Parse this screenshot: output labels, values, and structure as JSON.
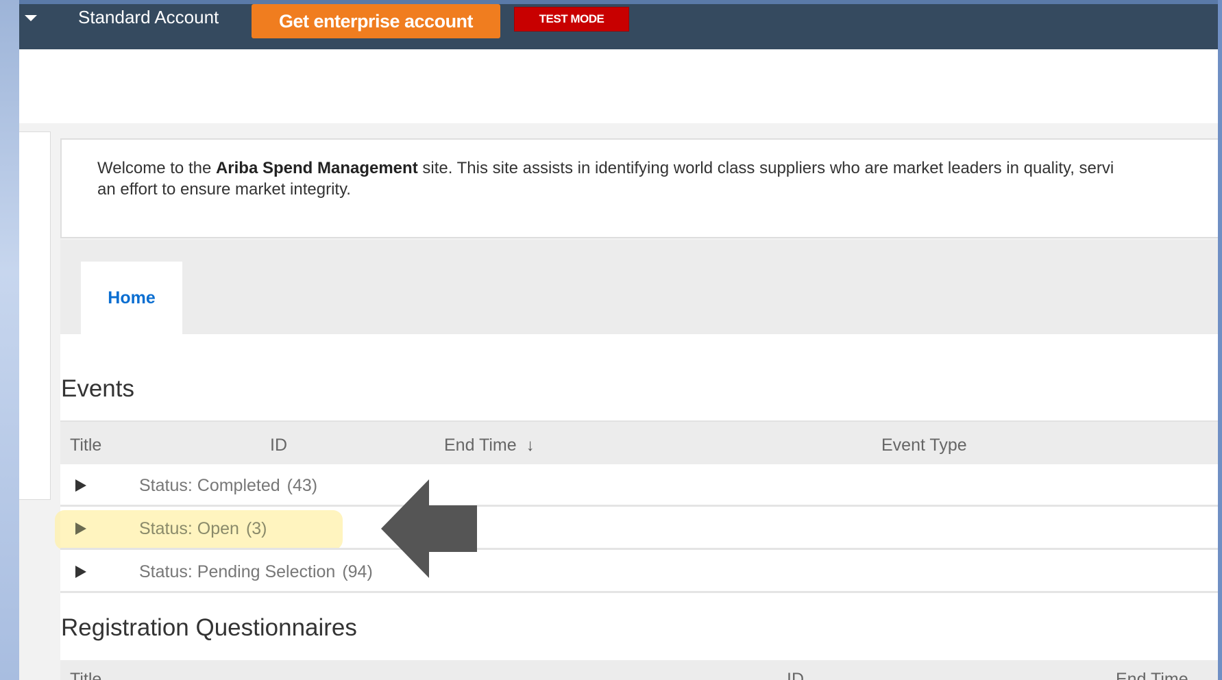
{
  "topbar": {
    "account_name": "Standard Account",
    "enterprise_button": "Get enterprise account",
    "test_mode_badge": "TEST MODE",
    "colors": {
      "bar": "#354a5f",
      "enterprise": "#f07d1f",
      "test_mode": "#c80000"
    }
  },
  "welcome": {
    "prefix": "Welcome to the ",
    "site_name": "Ariba Spend Management",
    "line1_rest": " site.  This site assists in identifying world class suppliers who are market leaders in quality, servi",
    "line2": "an effort to ensure market integrity."
  },
  "tabs": [
    {
      "label": "Home",
      "active": true
    }
  ],
  "events": {
    "title": "Events",
    "columns": [
      "Title",
      "ID",
      "End Time",
      "Event Type"
    ],
    "sort_icon": "arrow-down-icon",
    "groups": [
      {
        "label": "Status: Completed",
        "count": "(43)",
        "highlighted": false
      },
      {
        "label": "Status: Open",
        "count": "(3)",
        "highlighted": true
      },
      {
        "label": "Status: Pending Selection",
        "count": "(94)",
        "highlighted": false
      }
    ]
  },
  "questionnaires": {
    "title": "Registration Questionnaires",
    "columns": [
      "Title",
      "ID",
      "End Time"
    ]
  },
  "annotation": {
    "pointer_icon": "left-arrow-icon",
    "color": "#555555"
  }
}
